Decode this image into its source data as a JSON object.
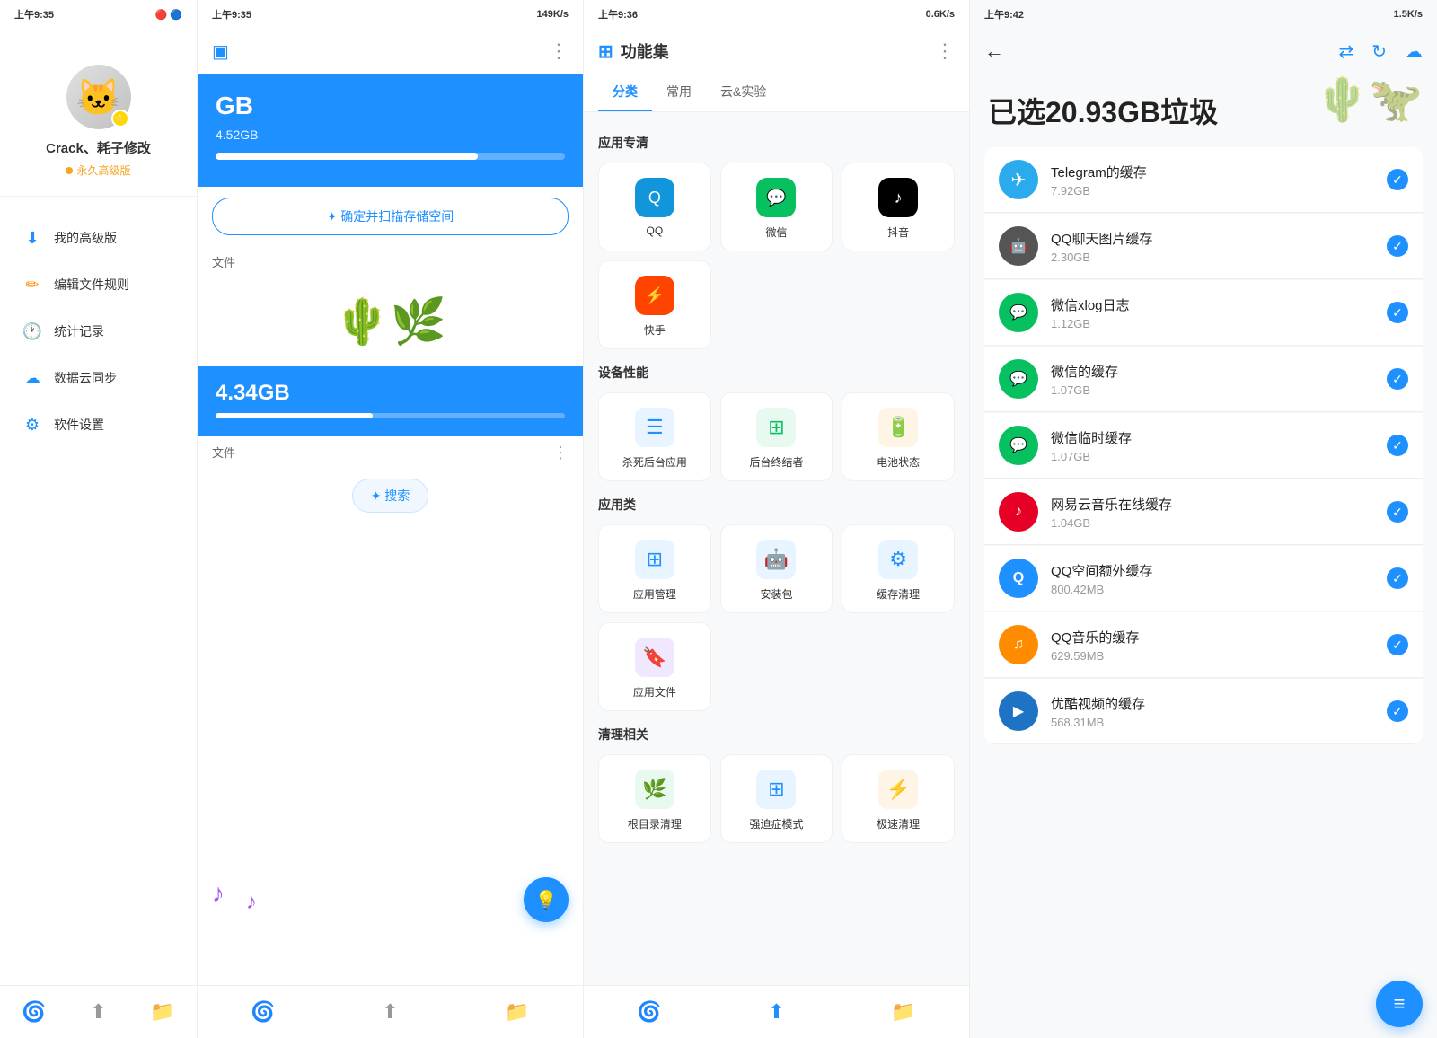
{
  "panel1": {
    "status_time": "上午9:35",
    "user_name": "Crack、耗子修改",
    "user_level": "永久高级版",
    "menu_items": [
      {
        "id": "premium",
        "label": "我的高级版",
        "icon": "⬇"
      },
      {
        "id": "rules",
        "label": "编辑文件规则",
        "icon": "✏"
      },
      {
        "id": "stats",
        "label": "统计记录",
        "icon": "🕐"
      },
      {
        "id": "cloud",
        "label": "数据云同步",
        "icon": "☁"
      },
      {
        "id": "settings",
        "label": "软件设置",
        "icon": "⚙"
      }
    ],
    "bottom_nav": [
      "🌀",
      "⬆",
      "📁"
    ]
  },
  "panel2": {
    "status_time": "上午9:35",
    "status_speed": "149K/s",
    "storage_title": "GB",
    "storage_sub": "4.52GB",
    "storage_bar_pct": 75,
    "storage_second": "4.34GB",
    "storage_second_bar_pct": 45,
    "file_label1": "文件",
    "file_label2": "文件",
    "confirm_btn": "✦ 确定并扫描存储空间",
    "search_btn": "✦ 搜索",
    "three_dots": "⋮",
    "float_icon": "💡",
    "music_note1": "♪",
    "music_note2": "♪",
    "bottom_nav": [
      "🌀",
      "⬆",
      "📁"
    ]
  },
  "panel3": {
    "status_time": "上午9:36",
    "status_speed": "0.6K/s",
    "title": "功能集",
    "title_icon": "⊞",
    "more_icon": "⋮",
    "tabs": [
      {
        "id": "category",
        "label": "分类",
        "active": true
      },
      {
        "id": "common",
        "label": "常用",
        "active": false
      },
      {
        "id": "cloud",
        "label": "云&实验",
        "active": false
      }
    ],
    "sections": [
      {
        "title": "应用专清",
        "items": [
          {
            "id": "qq",
            "label": "QQ",
            "icon_type": "qq"
          },
          {
            "id": "wechat",
            "label": "微信",
            "icon_type": "wechat"
          },
          {
            "id": "douyin",
            "label": "抖音",
            "icon_type": "douyin"
          },
          {
            "id": "kuaishou",
            "label": "快手",
            "icon_type": "kuaishou"
          }
        ]
      },
      {
        "title": "设备性能",
        "items": [
          {
            "id": "kill_bg",
            "label": "杀死后台应用",
            "icon_type": "func"
          },
          {
            "id": "bg_killer",
            "label": "后台终结者",
            "icon_type": "func_green"
          },
          {
            "id": "battery",
            "label": "电池状态",
            "icon_type": "func_orange"
          }
        ]
      },
      {
        "title": "应用类",
        "items": [
          {
            "id": "app_mgr",
            "label": "应用管理",
            "icon_type": "func"
          },
          {
            "id": "apk",
            "label": "安装包",
            "icon_type": "func"
          },
          {
            "id": "cache_clean",
            "label": "缓存清理",
            "icon_type": "func"
          },
          {
            "id": "app_file",
            "label": "应用文件",
            "icon_type": "func_purple"
          }
        ]
      },
      {
        "title": "清理相关",
        "items": [
          {
            "id": "dir_clean",
            "label": "根目录清理",
            "icon_type": "func_green"
          },
          {
            "id": "ocd",
            "label": "强迫症模式",
            "icon_type": "func"
          },
          {
            "id": "fast_clean",
            "label": "极速清理",
            "icon_type": "func_orange"
          }
        ]
      }
    ],
    "bottom_nav": [
      "🌀",
      "⬆",
      "📁"
    ]
  },
  "panel4": {
    "status_time": "上午9:42",
    "status_speed": "1.5K/s",
    "back_icon": "←",
    "action_icons": [
      "⇄",
      "↻",
      "☁"
    ],
    "hero_title": "已选20.93GB垃圾",
    "items": [
      {
        "id": "telegram",
        "name": "Telegram的缓存",
        "size": "7.92GB",
        "icon_type": "telegram",
        "icon_char": "✈"
      },
      {
        "id": "qq_img",
        "name": "QQ聊天图片缓存",
        "size": "2.30GB",
        "icon_type": "qq",
        "icon_char": "🤖"
      },
      {
        "id": "wechat_xlog",
        "name": "微信xlog日志",
        "size": "1.12GB",
        "icon_type": "wechat_green",
        "icon_char": "💬"
      },
      {
        "id": "wechat_cache",
        "name": "微信的缓存",
        "size": "1.07GB",
        "icon_type": "wechat_green",
        "icon_char": "💬"
      },
      {
        "id": "wechat_tmp",
        "name": "微信临时缓存",
        "size": "1.07GB",
        "icon_type": "wechat_green",
        "icon_char": "💬"
      },
      {
        "id": "netease",
        "name": "网易云音乐在线缓存",
        "size": "1.04GB",
        "icon_type": "netease",
        "icon_char": "♪"
      },
      {
        "id": "qqzone",
        "name": "QQ空间额外缓存",
        "size": "800.42MB",
        "icon_type": "qqzone",
        "icon_char": "Q"
      },
      {
        "id": "qqmusic",
        "name": "QQ音乐的缓存",
        "size": "629.59MB",
        "icon_type": "qqmusic",
        "icon_char": "♫"
      },
      {
        "id": "youku",
        "name": "优酷视频的缓存",
        "size": "568.31MB",
        "icon_type": "youku",
        "icon_char": "▶"
      }
    ],
    "float_btn_icon": "≡"
  }
}
